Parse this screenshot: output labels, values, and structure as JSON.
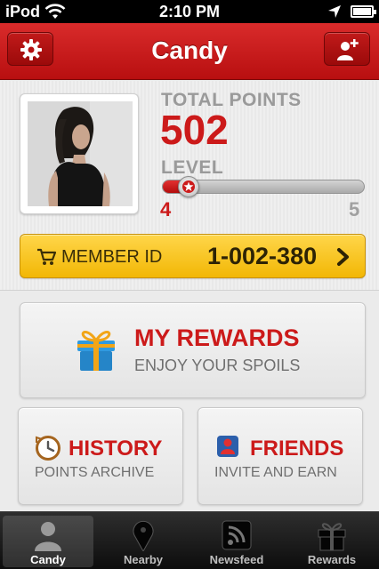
{
  "status_bar": {
    "carrier": "iPod",
    "time": "2:10 PM",
    "battery_level": 0.9
  },
  "nav": {
    "title": "Candy",
    "left_icon": "gear-icon",
    "right_icon": "add-user-icon"
  },
  "profile": {
    "total_points_label": "TOTAL POINTS",
    "total_points": "502",
    "level_label": "LEVEL",
    "level_current": "4",
    "level_next": "5",
    "level_progress": 0.13
  },
  "member": {
    "label": "MEMBER ID",
    "id": "1-002-380"
  },
  "tiles": {
    "rewards": {
      "title": "MY REWARDS",
      "subtitle": "ENJOY YOUR SPOILS"
    },
    "history": {
      "title": "HISTORY",
      "subtitle": "POINTS ARCHIVE"
    },
    "friends": {
      "title": "FRIENDS",
      "subtitle": "INVITE AND EARN"
    }
  },
  "tab_bar": {
    "tabs": [
      {
        "label": "Candy",
        "icon": "person-icon",
        "active": true
      },
      {
        "label": "Nearby",
        "icon": "map-pin-icon",
        "active": false
      },
      {
        "label": "Newsfeed",
        "icon": "rss-icon",
        "active": false
      },
      {
        "label": "Rewards",
        "icon": "gift-icon",
        "active": false
      }
    ]
  },
  "colors": {
    "brand_red": "#cc1a1a",
    "member_yellow": "#f7c51f",
    "tab_bar": "#1a1a1a"
  }
}
